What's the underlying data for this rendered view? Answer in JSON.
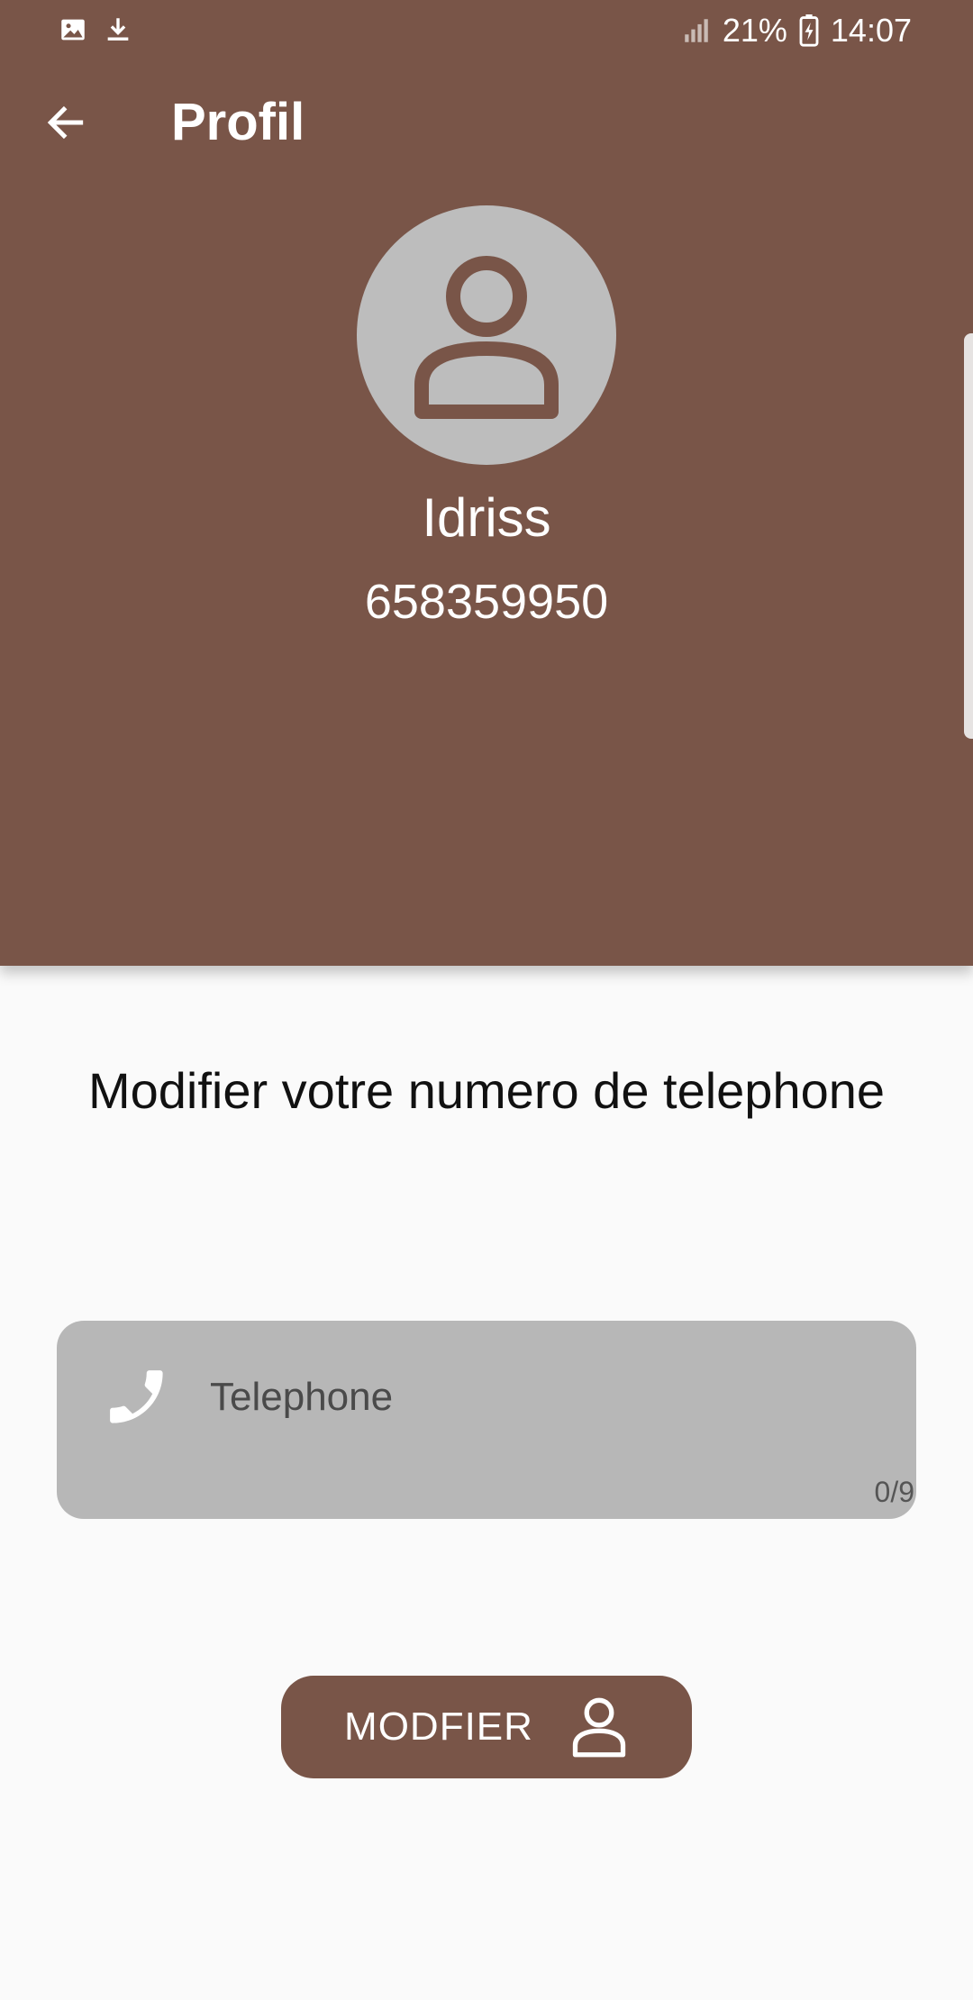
{
  "status_bar": {
    "icons_left": [
      "image-icon",
      "download-icon"
    ],
    "battery": "21%",
    "time": "14:07"
  },
  "toolbar": {
    "back_icon": "arrow-left-icon",
    "title": "Profil"
  },
  "profile": {
    "avatar_icon": "person-icon",
    "name": "Idriss",
    "phone": "658359950"
  },
  "form": {
    "heading": "Modifier votre numero de telephone",
    "phone_field": {
      "icon": "phone-icon",
      "placeholder": "Telephone",
      "value": "",
      "counter": "0/9"
    },
    "submit": {
      "label": "MODFIER",
      "icon": "user-icon"
    }
  },
  "colors": {
    "primary": "#795548",
    "avatar_bg": "#BDBDBD",
    "field_bg": "#B7B7B7",
    "page_bg": "#FAFAFA"
  }
}
